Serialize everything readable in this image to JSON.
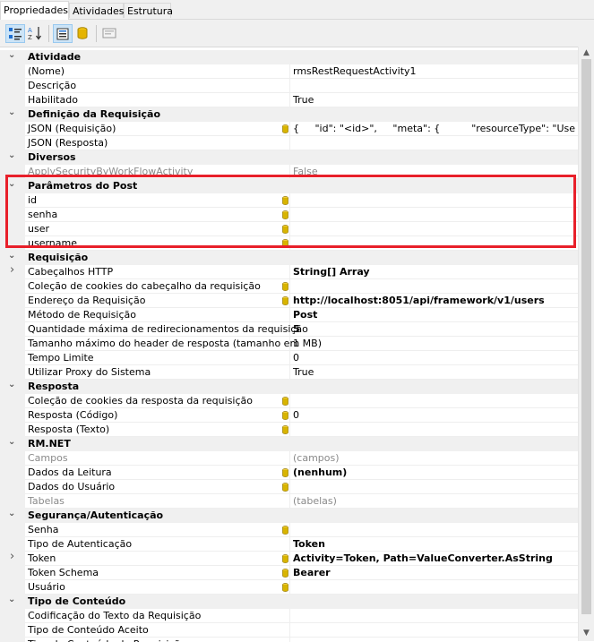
{
  "tabs": [
    {
      "label": "Propriedades",
      "active": true
    },
    {
      "label": "Atividades",
      "active": false
    },
    {
      "label": "Estrutura",
      "active": false
    }
  ],
  "toolbar": {
    "buttons": [
      {
        "name": "categorized-view-icon",
        "pressed": true
      },
      {
        "name": "alphabetical-sort-icon",
        "pressed": false
      },
      {
        "name": "properties-view-icon",
        "pressed": true
      },
      {
        "name": "database-icon",
        "pressed": false
      },
      {
        "name": "property-pages-icon",
        "pressed": false
      }
    ]
  },
  "rows": [
    {
      "kind": "cat",
      "label": "Atividade",
      "expanded": true
    },
    {
      "kind": "prop",
      "name": "(Nome)",
      "value": "rmsRestRequestActivity1"
    },
    {
      "kind": "prop",
      "name": "Descrição",
      "value": ""
    },
    {
      "kind": "prop",
      "name": "Habilitado",
      "value": "True"
    },
    {
      "kind": "cat",
      "label": "Definição da Requisição",
      "expanded": true
    },
    {
      "kind": "prop",
      "name": "JSON (Requisição)",
      "value": "{     \"id\": \"<id>\",     \"meta\": {          \"resourceType\": \"Use",
      "bind": true
    },
    {
      "kind": "prop",
      "name": "JSON (Resposta)",
      "value": ""
    },
    {
      "kind": "cat",
      "label": "Diversos",
      "expanded": true
    },
    {
      "kind": "prop",
      "name": "ApplySecurityByWorkFlowActivity",
      "value": "False",
      "grey": true
    },
    {
      "kind": "cat",
      "label": "Parâmetros do Post",
      "expanded": true
    },
    {
      "kind": "prop",
      "name": "id",
      "value": "",
      "bind": true
    },
    {
      "kind": "prop",
      "name": "senha",
      "value": "",
      "bind": true
    },
    {
      "kind": "prop",
      "name": "user",
      "value": "",
      "bind": true
    },
    {
      "kind": "prop",
      "name": "username",
      "value": "",
      "bind": true
    },
    {
      "kind": "cat",
      "label": "Requisição",
      "expanded": true
    },
    {
      "kind": "prop",
      "name": "Cabeçalhos HTTP",
      "value": "String[] Array",
      "bold": true,
      "collapsible": true
    },
    {
      "kind": "prop",
      "name": "Coleção de cookies do cabeçalho da requisição",
      "value": "",
      "bind": true
    },
    {
      "kind": "prop",
      "name": "Endereço da Requisição",
      "value": "http://localhost:8051/api/framework/v1/users",
      "bold": true,
      "bind": true
    },
    {
      "kind": "prop",
      "name": "Método de Requisição",
      "value": "Post",
      "bold": true
    },
    {
      "kind": "prop",
      "name": "Quantidade máxima de redirecionamentos da requisição",
      "value": "5",
      "bold": true
    },
    {
      "kind": "prop",
      "name": "Tamanho máximo do header de resposta (tamanho em MB)",
      "value": "1"
    },
    {
      "kind": "prop",
      "name": "Tempo Limite",
      "value": "0"
    },
    {
      "kind": "prop",
      "name": "Utilizar Proxy do Sistema",
      "value": "True"
    },
    {
      "kind": "cat",
      "label": "Resposta",
      "expanded": true
    },
    {
      "kind": "prop",
      "name": "Coleção de cookies da resposta da requisição",
      "value": "",
      "bind": true
    },
    {
      "kind": "prop",
      "name": "Resposta (Código)",
      "value": "0",
      "bind": true
    },
    {
      "kind": "prop",
      "name": "Resposta (Texto)",
      "value": "",
      "bind": true
    },
    {
      "kind": "cat",
      "label": "RM.NET",
      "expanded": true
    },
    {
      "kind": "prop",
      "name": "Campos",
      "value": "(campos)",
      "grey": true
    },
    {
      "kind": "prop",
      "name": "Dados da Leitura",
      "value": "(nenhum)",
      "bold": true,
      "bind": true
    },
    {
      "kind": "prop",
      "name": "Dados do Usuário",
      "value": "",
      "bind": true
    },
    {
      "kind": "prop",
      "name": "Tabelas",
      "value": "(tabelas)",
      "grey": true
    },
    {
      "kind": "cat",
      "label": "Segurança/Autenticação",
      "expanded": true
    },
    {
      "kind": "prop",
      "name": "Senha",
      "value": "",
      "bind": true
    },
    {
      "kind": "prop",
      "name": "Tipo de Autenticação",
      "value": "Token",
      "bold": true
    },
    {
      "kind": "prop",
      "name": "Token",
      "value": "Activity=Token, Path=ValueConverter.AsString",
      "bold": true,
      "bind": true,
      "collapsible": true
    },
    {
      "kind": "prop",
      "name": "Token Schema",
      "value": "Bearer",
      "bold": true,
      "bind": true
    },
    {
      "kind": "prop",
      "name": "Usuário",
      "value": "",
      "bind": true
    },
    {
      "kind": "cat",
      "label": "Tipo de Conteúdo",
      "expanded": true
    },
    {
      "kind": "prop",
      "name": "Codificação do Texto da Requisição",
      "value": ""
    },
    {
      "kind": "prop",
      "name": "Tipo de Conteúdo Aceito",
      "value": ""
    },
    {
      "kind": "prop",
      "name": "Tipo de Conteúdo da Requisição",
      "value": ""
    }
  ],
  "colors": {
    "highlight": "#e8202a",
    "category_bg": "#f0f0f0",
    "grey_text": "#8a8a8a",
    "binding_icon": "#d8b400"
  }
}
